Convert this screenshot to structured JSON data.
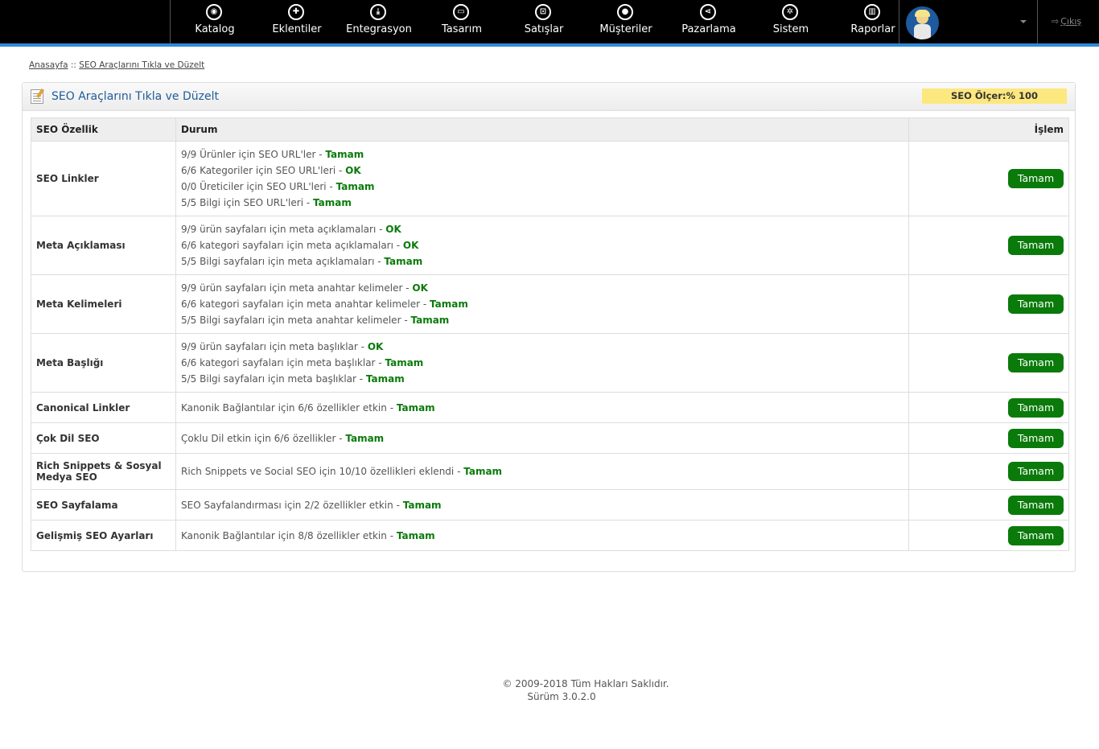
{
  "nav": {
    "items": [
      {
        "label": "Katalog",
        "icon": "tag-icon",
        "glyph": "◉"
      },
      {
        "label": "Eklentiler",
        "icon": "puzzle-icon",
        "glyph": "✚"
      },
      {
        "label": "Entegrasyon",
        "icon": "download-icon",
        "glyph": "⤓"
      },
      {
        "label": "Tasarım",
        "icon": "monitor-icon",
        "glyph": "▭"
      },
      {
        "label": "Satışlar",
        "icon": "cart-icon",
        "glyph": "⊡"
      },
      {
        "label": "Müşteriler",
        "icon": "user-icon",
        "glyph": "●"
      },
      {
        "label": "Pazarlama",
        "icon": "share-icon",
        "glyph": "⋖"
      },
      {
        "label": "Sistem",
        "icon": "gear-icon",
        "glyph": "✲"
      },
      {
        "label": "Raporlar",
        "icon": "bar-chart-icon",
        "glyph": "▥"
      }
    ],
    "logout_label": "Çıkış"
  },
  "breadcrumb": {
    "home": "Anasayfa",
    "separator": "::",
    "current": "SEO Araçlarını Tıkla ve Düzelt"
  },
  "panel": {
    "title": "SEO Araçlarını Tıkla ve Düzelt",
    "seo_meter": "SEO Ölçer:% 100"
  },
  "table": {
    "headers": {
      "feature": "SEO Özellik",
      "status": "Durum",
      "action": "İşlem"
    },
    "rows": [
      {
        "feature": "SEO Linkler",
        "lines": [
          {
            "text": "9/9 Ürünler için SEO URL'ler",
            "result": "Tamam"
          },
          {
            "text": "6/6 Kategoriler için SEO URL'leri",
            "result": "OK"
          },
          {
            "text": "0/0 Üreticiler için SEO URL'leri",
            "result": "Tamam"
          },
          {
            "text": "5/5 Bilgi için SEO URL'leri",
            "result": "Tamam"
          }
        ],
        "button": "Tamam"
      },
      {
        "feature": "Meta Açıklaması",
        "lines": [
          {
            "text": "9/9 ürün sayfaları için meta açıklamaları",
            "result": "OK"
          },
          {
            "text": "6/6 kategori sayfaları için meta açıklamaları",
            "result": "OK"
          },
          {
            "text": "5/5 Bilgi sayfaları için meta açıklamaları",
            "result": "Tamam"
          }
        ],
        "button": "Tamam"
      },
      {
        "feature": "Meta Kelimeleri",
        "lines": [
          {
            "text": "9/9 ürün sayfaları için meta anahtar kelimeler",
            "result": "OK"
          },
          {
            "text": "6/6 kategori sayfaları için meta anahtar kelimeler",
            "result": "Tamam"
          },
          {
            "text": "5/5 Bilgi sayfaları için meta anahtar kelimeler",
            "result": "Tamam"
          }
        ],
        "button": "Tamam"
      },
      {
        "feature": "Meta Başlığı",
        "lines": [
          {
            "text": "9/9 ürün sayfaları için meta başlıklar",
            "result": "OK"
          },
          {
            "text": "6/6 kategori sayfaları için meta başlıklar",
            "result": "Tamam"
          },
          {
            "text": "5/5 Bilgi sayfaları için meta başlıklar",
            "result": "Tamam"
          }
        ],
        "button": "Tamam"
      },
      {
        "feature": "Canonical Linkler",
        "lines": [
          {
            "text": "Kanonik Bağlantılar için 6/6 özellikler etkin",
            "result": "Tamam"
          }
        ],
        "button": "Tamam"
      },
      {
        "feature": "Çok Dil SEO",
        "lines": [
          {
            "text": "Çoklu Dil etkin için 6/6 özellikler",
            "result": "Tamam"
          }
        ],
        "button": "Tamam"
      },
      {
        "feature": "Rich Snippets & Sosyal Medya SEO",
        "lines": [
          {
            "text": "Rich Snippets ve Social SEO için 10/10 özellikleri eklendi",
            "result": "Tamam"
          }
        ],
        "button": "Tamam"
      },
      {
        "feature": "SEO Sayfalama",
        "lines": [
          {
            "text": "SEO Sayfalandırması için 2/2 özellikler etkin",
            "result": "Tamam"
          }
        ],
        "button": "Tamam"
      },
      {
        "feature": "Gelişmiş SEO Ayarları",
        "lines": [
          {
            "text": "Kanonik Bağlantılar için 8/8 özellikler etkin",
            "result": "Tamam"
          }
        ],
        "button": "Tamam"
      }
    ]
  },
  "footer": {
    "copyright": "© 2009-2018 Tüm Hakları Saklıdır.",
    "version": "Sürüm 3.0.2.0"
  },
  "colors": {
    "topbar": "#000000",
    "accent_line": "#2f8ad8",
    "ok_green": "#0a7a0a",
    "meter_yellow": "#fde77f",
    "title_blue": "#1f5c99"
  }
}
